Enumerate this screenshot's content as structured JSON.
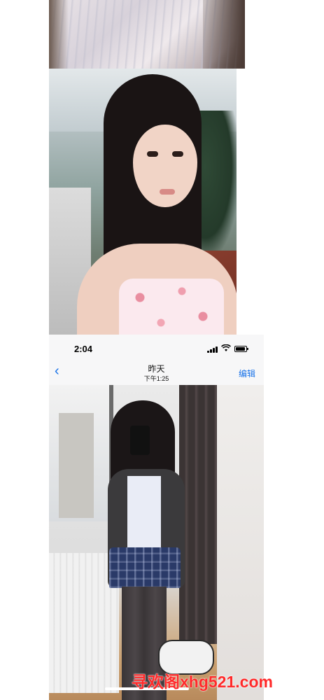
{
  "status_bar": {
    "time": "2:04",
    "wifi_icon": "wifi-icon",
    "signal_icon": "cellular-signal-icon",
    "battery_icon": "battery-icon"
  },
  "nav": {
    "back_icon": "chevron-left-icon",
    "back_glyph": "‹",
    "title": "昨天",
    "subtitle": "下午1:25",
    "edit_label": "编辑"
  },
  "watermark": {
    "text": "寻欢阁xhg521.com"
  },
  "colors": {
    "accent_blue": "#1a73e8",
    "watermark_red": "#ff2a2a"
  }
}
